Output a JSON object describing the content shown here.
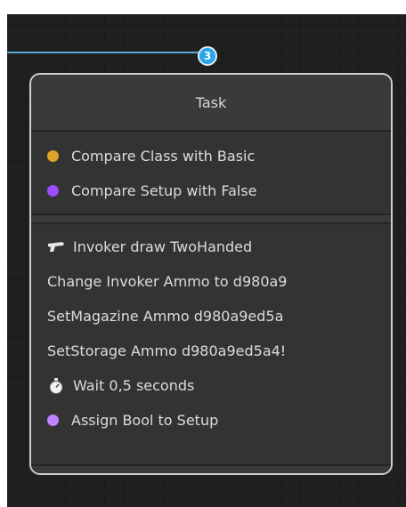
{
  "port": {
    "number": "3"
  },
  "node": {
    "title": "Task",
    "conditions": [
      {
        "label": "Compare Class with Basic",
        "dot_color": "#e0a32a"
      },
      {
        "label": "Compare Setup with False",
        "dot_color": "#9b4dff"
      }
    ],
    "actions": [
      {
        "label": "Invoker draw TwoHanded",
        "icon": "gun-icon"
      },
      {
        "label": "Change Invoker Ammo to d980a9"
      },
      {
        "label": "SetMagazine Ammo d980a9ed5a"
      },
      {
        "label": "SetStorage Ammo d980a9ed5a4!"
      },
      {
        "label": "Wait 0,5 seconds",
        "icon": "stopwatch-icon"
      },
      {
        "label": "Assign Bool to Setup",
        "dot_color": "#c081ff"
      }
    ]
  },
  "colors": {
    "connection": "#5aa7d8",
    "port_badge": "#2aa4e8",
    "node_border": "#cfcfcf"
  }
}
